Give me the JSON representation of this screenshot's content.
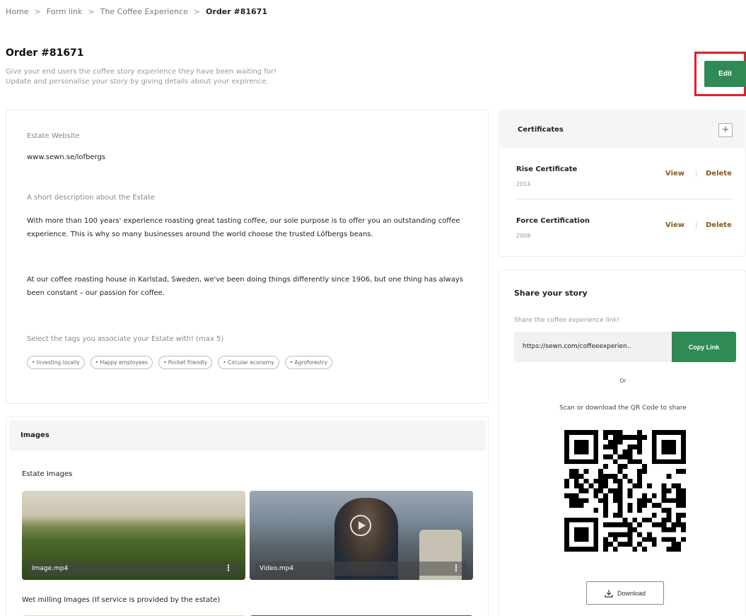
{
  "breadcrumb": {
    "items": [
      "Home",
      "Form link",
      "The Coffee Experience"
    ],
    "current": "Order #81671",
    "separator": ">"
  },
  "header": {
    "title": "Order #81671",
    "subtitle_line1": "Give your end users the coffee story experience they have been waiting for!",
    "subtitle_line2": "Update and personalise your story by giving details about your expirence.",
    "edit_label": "Edit"
  },
  "estate": {
    "website_label": "Estate Website",
    "website_value": "www.sewn.se/lofbergs",
    "description_label": "A short description about the Estate",
    "paragraph1": "With more than 100 years' experience roasting great tasting coffee, our sole purpose is to offer you an outstanding coffee experience. This is why so many businesses around the world choose the trusted Löfbergs beans.",
    "paragraph2": "At our coffee roasting house in Karlstad, Sweden, we've been doing things differently since 1906, but one thing has always been constant – our passion for coffee.",
    "tags_label": "Select the tags you associate your Estate with! (max 5)",
    "tags": [
      "• Investing locally",
      "• Happy employees",
      "• Pocket friendly",
      "• Circular economy",
      "• Agroforestry"
    ]
  },
  "images": {
    "section_title": "Images",
    "estate_label": "Estate Images",
    "files": [
      "Image.mp4",
      "Video.mp4"
    ],
    "wet_milling_label": "Wet milling Images (If service is provided by the estate)"
  },
  "certificates": {
    "title": "Certificates",
    "items": [
      {
        "name": "Rise Certificate",
        "year": "2014",
        "view": "View",
        "delete": "Delete"
      },
      {
        "name": "Force Certification",
        "year": "2008",
        "view": "View",
        "delete": "Delete"
      }
    ]
  },
  "share": {
    "title": "Share your story",
    "subtitle": "Share the coffee experience link!",
    "link": "https://sewn.com/coffeeexperien..",
    "copy_label": "Copy Link",
    "or_text": "Or",
    "scan_text": "Scan or download the QR Code to share",
    "download_label": "Download"
  },
  "colors": {
    "accent_green": "#2f8a55",
    "link_brown": "#8a5a18",
    "highlight_red": "#e0202a"
  }
}
